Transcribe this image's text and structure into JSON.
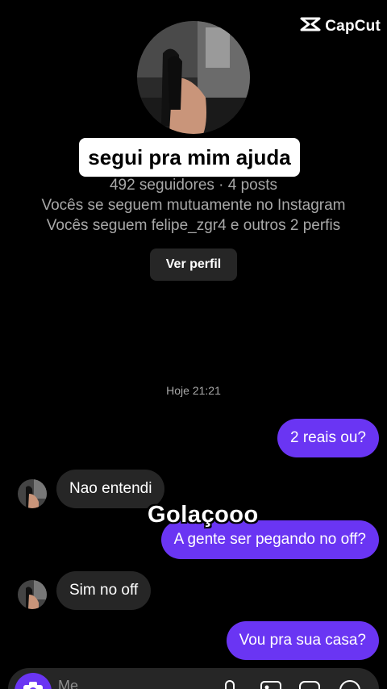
{
  "watermark": {
    "text": "CapCut",
    "icon": "capcut-logo-icon"
  },
  "profile": {
    "name": "segui pra mim ajuda",
    "stats": "492 seguidores · 4 posts",
    "mutual": "Vocês se seguem mutuamente no Instagram",
    "followed_by": "Vocês seguem felipe_zgr4 e outros 2 perfis",
    "view_profile_label": "Ver perfil"
  },
  "thread": {
    "timestamp": "Hoje 21:21",
    "messages": [
      {
        "direction": "out",
        "text": "2 reais ou?"
      },
      {
        "direction": "in",
        "text": "Nao entendi"
      },
      {
        "direction": "out",
        "text": "A gente ser pegando no off?"
      },
      {
        "direction": "in",
        "text": "Sim no off"
      },
      {
        "direction": "out",
        "text": "Vou pra sua casa?"
      }
    ]
  },
  "overlay_caption": "Golaçooo",
  "composer": {
    "placeholder": "Me",
    "icons": [
      "camera-icon",
      "microphone-icon",
      "image-icon",
      "sticker-icon",
      "plus-icon"
    ]
  },
  "colors": {
    "outgoing_bubble": "#6a35f3",
    "incoming_bubble": "#262626",
    "background": "#000000"
  }
}
